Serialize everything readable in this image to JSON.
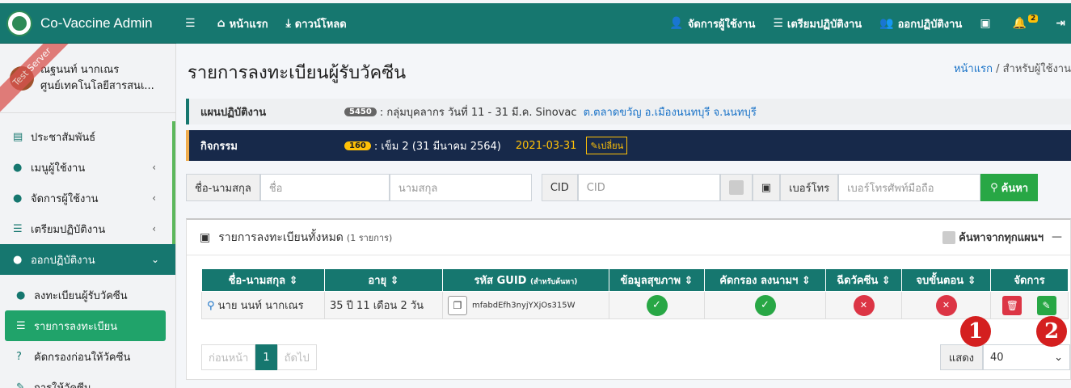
{
  "brand": {
    "name": "Co-Vaccine Admin"
  },
  "nav": {
    "menu_icon": "menu-icon",
    "home": "หน้าแรก",
    "download": "ดาวน์โหลด",
    "manage_users": "จัดการผู้ใช้งาน",
    "prepare": "เตรียมปฏิบัติงาน",
    "operate": "ออกปฏิบัติงาน",
    "bell_count": "2"
  },
  "user": {
    "name": "ณฐนนท์ นากเณร",
    "org": "ศูนย์เทคโนโลยีสารสนเ...",
    "ribbon": "Test Server"
  },
  "sidebar": {
    "items": [
      {
        "label": "ประชาสัมพันธ์"
      },
      {
        "label": "เมนูผู้ใช้งาน"
      },
      {
        "label": "จัดการผู้ใช้งาน"
      },
      {
        "label": "เตรียมปฏิบัติงาน"
      },
      {
        "label": "ออกปฏิบัติงาน"
      }
    ],
    "sub": [
      {
        "label": "ลงทะเบียนผู้รับวัคซีน"
      },
      {
        "label": "รายการลงทะเบียน"
      },
      {
        "label": "คัดกรองก่อนให้วัคซีน"
      },
      {
        "label": "การให้วัคซีน"
      }
    ]
  },
  "page": {
    "title": "รายการลงทะเบียนผู้รับวัคซีน",
    "breadcrumb_home": "หน้าแรก",
    "breadcrumb_current": "สำหรับผู้ใช้งาน"
  },
  "plan": {
    "label": "แผนปฏิบัติงาน",
    "badge": "5450",
    "text": ": กลุ่มบุคลากร วันที่ 11 - 31 มี.ค. Sinovac",
    "location": "ต.ตลาดขวัญ อ.เมืองนนทบุรี จ.นนทบุรี"
  },
  "activity": {
    "label": "กิจกรรม",
    "badge": "160",
    "text": ": เข็ม 2 (31 มีนาคม 2564)",
    "date": "2021-03-31",
    "change": "เปลี่ยน"
  },
  "search": {
    "name_label": "ชื่อ-นามสกุล",
    "first_placeholder": "ชื่อ",
    "last_placeholder": "นามสกุล",
    "cid_label": "CID",
    "cid_placeholder": "CID",
    "phone_label": "เบอร์โทร",
    "phone_placeholder": "เบอร์โทรศัพท์มือถือ",
    "button": "ค้นหา"
  },
  "card": {
    "title": "รายการลงทะเบียนทั้งหมด",
    "count": "(1 รายการ)",
    "search_all": "ค้นหาจากทุกแผนฯ",
    "collapse": "—"
  },
  "table": {
    "headers": [
      "ชื่อ-นามสกุล ⇕",
      "อายุ ⇕",
      "รหัส GUID",
      "ข้อมูลสุขภาพ ⇕",
      "คัดกรอง ลงนามฯ ⇕",
      "ฉีดวัคซีน ⇕",
      "จบขั้นตอน ⇕",
      "จัดการ"
    ],
    "guid_note": "(สำหรับค้นหา)",
    "row": {
      "name": "นาย นนท์ นากเณร",
      "age": "35 ปี 11 เดือน 2 วัน",
      "guid": "mfabdEfh3nyjYXjOs315W"
    }
  },
  "pager": {
    "prev": "ก่อนหน้า",
    "page": "1",
    "next": "ถัดไป"
  },
  "show": {
    "label": "แสดง",
    "value": "40"
  },
  "markers": [
    "1",
    "2"
  ]
}
